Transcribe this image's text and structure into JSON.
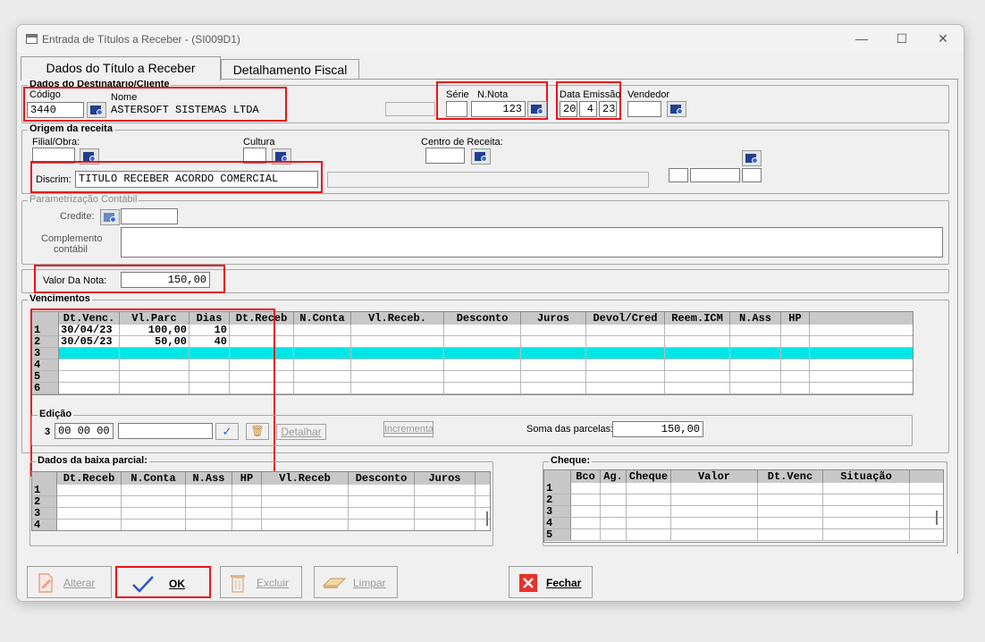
{
  "window": {
    "title": "Entrada de Títulos a Receber - (SI009D1)",
    "minimize": "—",
    "maximize": "☐",
    "close": "✕"
  },
  "tabs": [
    {
      "label": "Dados do Título a Receber"
    },
    {
      "label": "Detalhamento Fiscal"
    }
  ],
  "destinatario": {
    "group_title": "Dados do Destinatário/Cliente",
    "codigo_label": "Código",
    "codigo": "3440",
    "nome_label": "Nome",
    "nome": "ASTERSOFT SISTEMAS LTDA",
    "serie_label": "Série",
    "serie": "",
    "nnota_label": "N.Nota",
    "nnota": "123",
    "data_label": "Data Emissão",
    "data_d": "20",
    "data_m": "4",
    "data_y": "23",
    "vendedor_label": "Vendedor",
    "vendedor": ""
  },
  "origem": {
    "group_title": "Origem da receita",
    "filial_label": "Filial/Obra:",
    "cultura_label": "Cultura",
    "centro_label": "Centro de Receita:",
    "discrim_label": "Discrim:",
    "discrim": "TITULO RECEBER ACORDO COMERCIAL"
  },
  "param": {
    "group_title": "Parametrização Contábil",
    "credite_label": "Credite:",
    "complemento_label_1": "Complemento",
    "complemento_label_2": "contábil"
  },
  "valor": {
    "label": "Valor Da Nota:",
    "value": "150,00"
  },
  "vencimentos": {
    "group_title": "Vencimentos",
    "headers": [
      "Dt.Venc.",
      "Vl.Parc",
      "Dias",
      "Dt.Receb",
      "N.Conta",
      "Vl.Receb.",
      "Desconto",
      "Juros",
      "Devol/Cred",
      "Reem.ICM",
      "N.Ass",
      "HP"
    ],
    "row_numbers": [
      "1",
      "2",
      "3",
      "4",
      "5",
      "6"
    ],
    "rows": [
      [
        "30/04/23",
        "100,00",
        "10"
      ],
      [
        "30/05/23",
        "50,00",
        "40"
      ]
    ],
    "edicao_title": "Edição",
    "edicao_row": "3",
    "edicao_date": "00 00 00",
    "detalhar": "Detalhar",
    "incrementa": "Incrementa",
    "soma_label": "Soma das parcelas:",
    "soma": "150,00"
  },
  "baixa": {
    "group_title": "Dados da baixa parcial:",
    "headers": [
      "Dt.Receb",
      "N.Conta",
      "N.Ass",
      "HP",
      "Vl.Receb",
      "Desconto",
      "Juros"
    ],
    "row_numbers": [
      "1",
      "2",
      "3",
      "4"
    ]
  },
  "cheque": {
    "group_title": "Cheque:",
    "headers": [
      "Bco",
      "Ag.",
      "Cheque",
      "Valor",
      "Dt.Venc",
      "Situação"
    ],
    "row_numbers": [
      "1",
      "2",
      "3",
      "4",
      "5"
    ]
  },
  "buttons": {
    "alterar": "Alterar",
    "ok": "OK",
    "excluir": "Excluir",
    "limpar": "Limpar",
    "fechar": "Fechar"
  },
  "colors": {
    "highlight": "#e8141b",
    "selected_row": "#00e6e6",
    "ok_check": "#2255cc",
    "close_red": "#e8312a"
  }
}
